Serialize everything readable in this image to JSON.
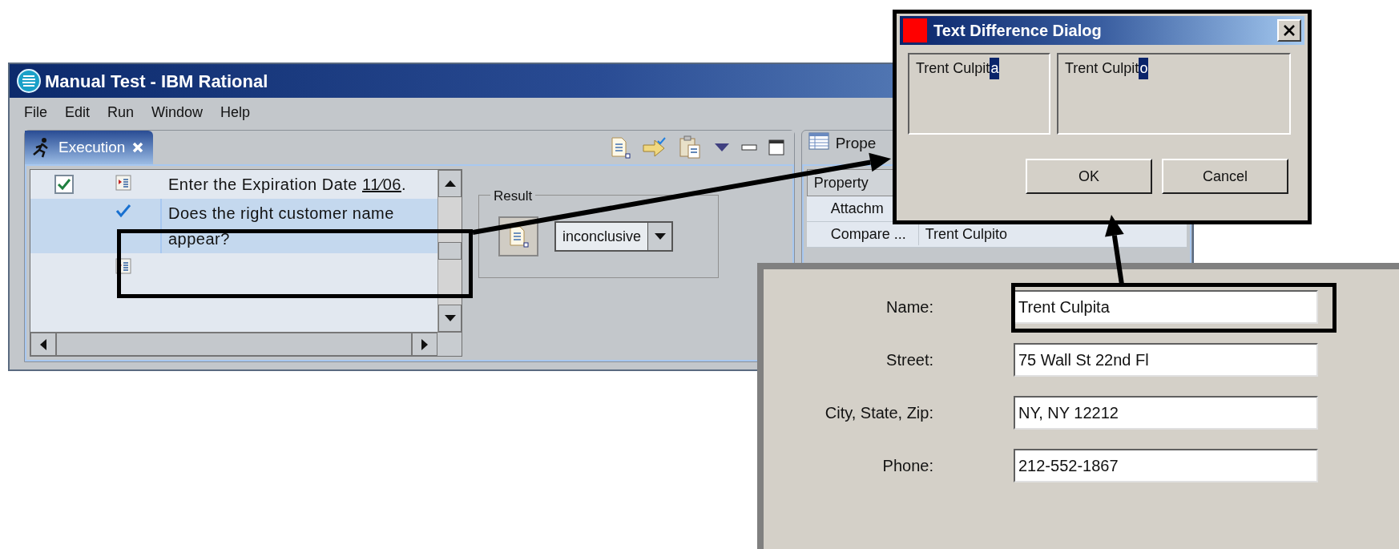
{
  "main_window": {
    "title": "Manual Test - IBM Rational",
    "menu": [
      "File",
      "Edit",
      "Run",
      "Window",
      "Help"
    ],
    "execution": {
      "tab": "Execution",
      "steps": [
        {
          "kind": "step",
          "checked": true,
          "selected": false,
          "text": "Enter the Expiration Date",
          "link": "11⁄06",
          "suffix": "."
        },
        {
          "kind": "verification",
          "checked": true,
          "selected": true,
          "text": "Does the right customer name appear?"
        },
        {
          "kind": "step",
          "selected": false
        }
      ],
      "result": {
        "label": "Result",
        "value": "inconclusive"
      }
    },
    "properties": {
      "tab": "Prope",
      "header": "Property",
      "rows": [
        {
          "name": "Attachm"
        },
        {
          "name": "Compare ...",
          "value": "Trent Culpito"
        }
      ]
    }
  },
  "dialog": {
    "title": "Text Difference Dialog",
    "left": {
      "same": "Trent Culpit",
      "diff": "a"
    },
    "right": {
      "same": "Trent Culpit",
      "diff": "o"
    },
    "buttons": [
      "OK",
      "Cancel"
    ]
  },
  "form": {
    "fields": [
      {
        "label": "Name:",
        "value": "Trent Culpita"
      },
      {
        "label": "Street:",
        "value": "75 Wall St 22nd Fl"
      },
      {
        "label": "City, State, Zip:",
        "value": "NY, NY 12212"
      },
      {
        "label": "Phone:",
        "value": "212-552-1867"
      }
    ]
  }
}
